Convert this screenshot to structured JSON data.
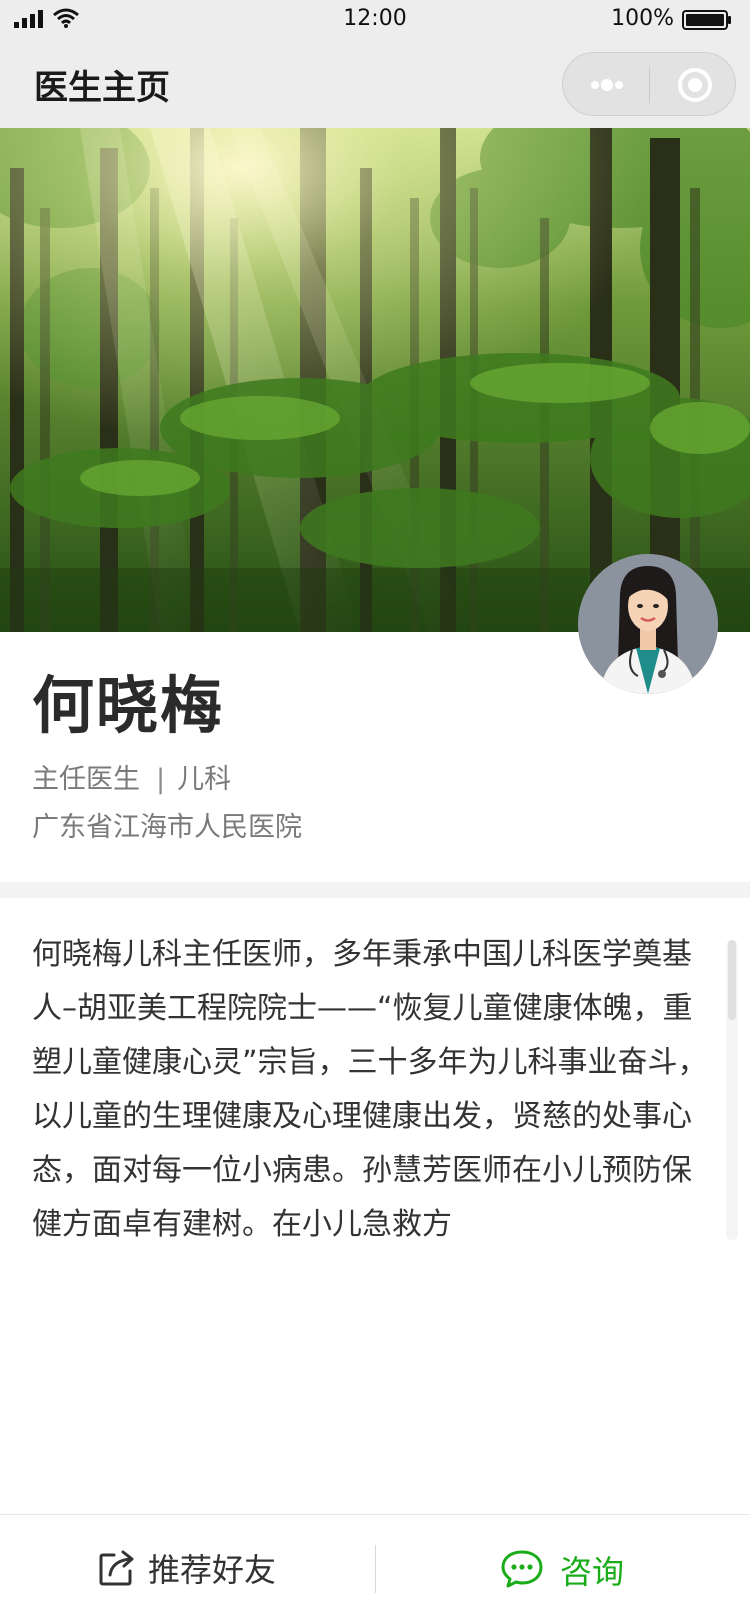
{
  "status_bar": {
    "time": "12:00",
    "battery_text": "100%",
    "icons": [
      "signal-icon",
      "wifi-icon",
      "battery-icon"
    ]
  },
  "nav": {
    "title": "医生主页",
    "capsule_icons": [
      "more-icon",
      "close-icon"
    ]
  },
  "doctor": {
    "name": "何晓梅",
    "title": "主任医生",
    "separator": "|",
    "department": "儿科",
    "hospital": "广东省江海市人民医院"
  },
  "intro": {
    "text": "何晓梅儿科主任医师，多年秉承中国儿科医学奠基人–胡亚美工程院院士——“恢复儿童健康体魄，重塑儿童健康心灵”宗旨，三十多年为儿科事业奋斗，以儿童的生理健康及心理健康出发，贤慈的处事心态，面对每一位小病患。孙慧芳医师在小儿预防保健方面卓有建树。在小儿急救方"
  },
  "bottom_bar": {
    "recommend_label": "推荐好友",
    "consult_label": "咨询"
  },
  "colors": {
    "accent_green": "#1aad19",
    "nav_bg": "#ededed",
    "text_primary": "#333333",
    "text_secondary": "#7a7a7a"
  }
}
